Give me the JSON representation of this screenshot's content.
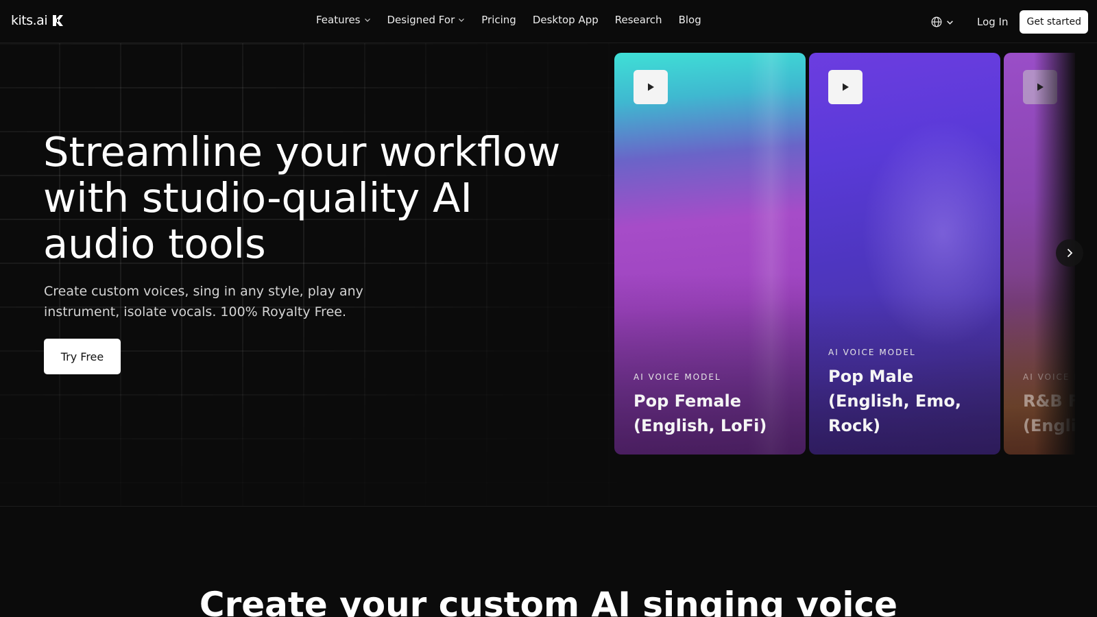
{
  "nav": {
    "logo_text": "kits.ai",
    "links": [
      {
        "label": "Features",
        "dropdown": true
      },
      {
        "label": "Designed For",
        "dropdown": true
      },
      {
        "label": "Pricing",
        "dropdown": false
      },
      {
        "label": "Desktop App",
        "dropdown": false
      },
      {
        "label": "Research",
        "dropdown": false
      },
      {
        "label": "Blog",
        "dropdown": false
      }
    ],
    "language_icon": "globe-icon",
    "login_label": "Log In",
    "cta_label": "Get started"
  },
  "hero": {
    "title": "Streamline your workflow with studio-quality AI audio tools",
    "subtitle": "Create custom voices, sing in any style, play any instrument, isolate vocals. 100% Royalty Free.",
    "button_label": "Try Free"
  },
  "cards": [
    {
      "kicker": "AI VOICE MODEL",
      "title": "Pop Female (English, LoFi)"
    },
    {
      "kicker": "AI VOICE MODEL",
      "title": "Pop Male (English, Emo, Rock)"
    },
    {
      "kicker": "AI VOICE MODEL",
      "title": "R&B Female (English"
    }
  ],
  "section": {
    "title": "Create your custom AI singing voice"
  },
  "colors": {
    "background": "#0b0b0b",
    "button_bg": "#ffffff",
    "text": "#ffffff"
  }
}
